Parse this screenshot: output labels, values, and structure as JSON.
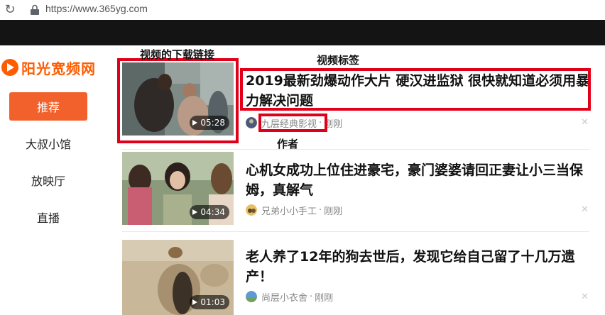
{
  "browser": {
    "url": "https://www.365yg.com"
  },
  "sidebar": {
    "logo_text": "阳光宽频网",
    "items": [
      {
        "label": "推荐",
        "active": true
      },
      {
        "label": "大叔小馆",
        "active": false
      },
      {
        "label": "放映厅",
        "active": false
      },
      {
        "label": "直播",
        "active": false
      }
    ]
  },
  "feed": [
    {
      "title": "2019最新劲爆动作大片 硬汉进监狱 很快就知道必须用暴力解决问题",
      "duration": "05:28",
      "author": "九层经典影视",
      "time": "刚刚",
      "separator": "·"
    },
    {
      "title": "心机女成功上位住进豪宅，豪门婆婆请回正妻让小三当保姆，真解气",
      "duration": "04:34",
      "author": "兄弟小小手工",
      "time": "刚刚",
      "separator": "·"
    },
    {
      "title": "老人养了12年的狗去世后，发现它给自己留了十几万遗产！",
      "duration": "01:03",
      "author": "尚层小衣舍",
      "time": "刚刚",
      "separator": "·"
    }
  ],
  "annotations": {
    "download_link": "视频的下载链接",
    "video_title": "视频标签",
    "author": "作者"
  },
  "colors": {
    "accent": "#f2612b",
    "logo": "#ff5c00",
    "annotation_red": "#e1001a",
    "top_bar": "#141414"
  }
}
